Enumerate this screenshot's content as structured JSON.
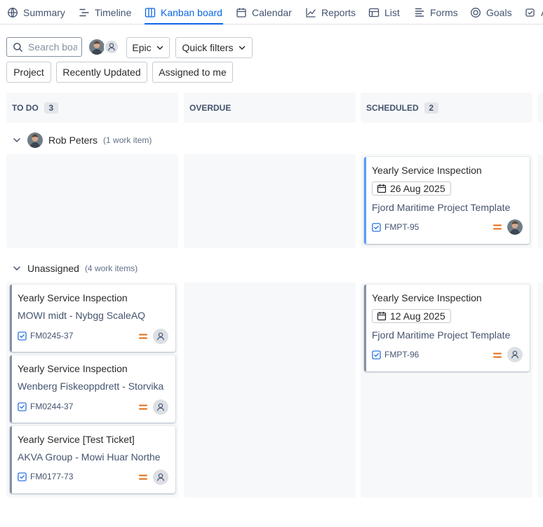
{
  "nav": {
    "tabs": [
      {
        "label": "Summary",
        "icon": "globe-icon"
      },
      {
        "label": "Timeline",
        "icon": "timeline-icon"
      },
      {
        "label": "Kanban board",
        "icon": "board-icon",
        "active": true
      },
      {
        "label": "Calendar",
        "icon": "calendar-icon"
      },
      {
        "label": "Reports",
        "icon": "chart-line-icon"
      },
      {
        "label": "List",
        "icon": "list-icon"
      },
      {
        "label": "Forms",
        "icon": "forms-icon"
      },
      {
        "label": "Goals",
        "icon": "goal-icon"
      },
      {
        "label": "A",
        "icon": "more-icon"
      }
    ],
    "accent": "#0c66e4"
  },
  "toolbar": {
    "search_placeholder": "Search board",
    "epic_label": "Epic",
    "quick_filters_label": "Quick filters",
    "filters": [
      "Project",
      "Recently Updated",
      "Assigned to me"
    ]
  },
  "columns": [
    {
      "name": "TO DO",
      "count": "3"
    },
    {
      "name": "OVERDUE",
      "count": ""
    },
    {
      "name": "SCHEDULED",
      "count": "2"
    }
  ],
  "swimlanes": {
    "rob": {
      "name": "Rob Peters",
      "count": "(1 work item)"
    },
    "unassigned": {
      "name": "Unassigned",
      "count": "(4 work items)"
    }
  },
  "cards": {
    "rob_scheduled": {
      "title": "Yearly Service Inspection",
      "date": "26 Aug 2025",
      "subtitle": "Fjord Maritime Project Template",
      "key": "FMPT-95"
    },
    "un_todo_1": {
      "title": "Yearly Service Inspection",
      "subtitle": "MOWI midt - Nybgg ScaleAQ",
      "key": "FM0245-37"
    },
    "un_todo_2": {
      "title": "Yearly Service Inspection",
      "subtitle": "Wenberg Fiskeoppdrett - Storvika",
      "key": "FM0244-37"
    },
    "un_todo_3": {
      "title": "Yearly Service [Test Ticket]",
      "subtitle": "AKVA Group - Mowi Huar Northe",
      "key": "FM0177-73"
    },
    "un_scheduled": {
      "title": "Yearly Service Inspection",
      "date": "12 Aug 2025",
      "subtitle": "Fjord Maritime Project Template",
      "key": "FMPT-96"
    }
  },
  "colors": {
    "priority_medium": "#e56910",
    "task_icon": "#1868db",
    "lane_bg": "#f7f8f9",
    "card_accent_scheduled": "#579dff"
  }
}
